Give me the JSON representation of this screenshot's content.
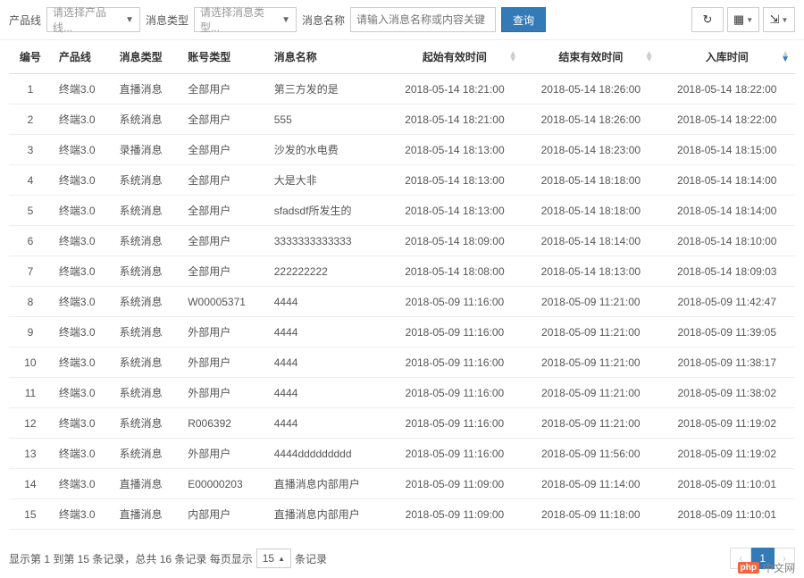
{
  "filters": {
    "productLineLabel": "产品线",
    "productLinePlaceholder": "请选择产品线...",
    "messageTypeLabel": "消息类型",
    "messageTypePlaceholder": "请选择消息类型...",
    "messageNameLabel": "消息名称",
    "messageNamePlaceholder": "请输入消息名称或内容关键",
    "queryBtn": "查询"
  },
  "icons": {
    "refresh": "↻",
    "columns": "▦",
    "export": "⇲"
  },
  "table": {
    "headers": {
      "index": "编号",
      "productLine": "产品线",
      "messageType": "消息类型",
      "accountType": "账号类型",
      "messageName": "消息名称",
      "startTime": "起始有效时间",
      "endTime": "结束有效时间",
      "storeTime": "入库时间"
    },
    "rows": [
      {
        "i": "1",
        "pl": "终端3.0",
        "mt": "直播消息",
        "at": "全部用户",
        "mn": "第三方发的是",
        "st": "2018-05-14 18:21:00",
        "et": "2018-05-14 18:26:00",
        "it": "2018-05-14 18:22:00"
      },
      {
        "i": "2",
        "pl": "终端3.0",
        "mt": "系统消息",
        "at": "全部用户",
        "mn": "555",
        "st": "2018-05-14 18:21:00",
        "et": "2018-05-14 18:26:00",
        "it": "2018-05-14 18:22:00"
      },
      {
        "i": "3",
        "pl": "终端3.0",
        "mt": "录播消息",
        "at": "全部用户",
        "mn": "沙发的水电费",
        "st": "2018-05-14 18:13:00",
        "et": "2018-05-14 18:23:00",
        "it": "2018-05-14 18:15:00"
      },
      {
        "i": "4",
        "pl": "终端3.0",
        "mt": "系统消息",
        "at": "全部用户",
        "mn": "大是大非",
        "st": "2018-05-14 18:13:00",
        "et": "2018-05-14 18:18:00",
        "it": "2018-05-14 18:14:00"
      },
      {
        "i": "5",
        "pl": "终端3.0",
        "mt": "系统消息",
        "at": "全部用户",
        "mn": "sfadsdf所发生的",
        "st": "2018-05-14 18:13:00",
        "et": "2018-05-14 18:18:00",
        "it": "2018-05-14 18:14:00"
      },
      {
        "i": "6",
        "pl": "终端3.0",
        "mt": "系统消息",
        "at": "全部用户",
        "mn": "3333333333333",
        "st": "2018-05-14 18:09:00",
        "et": "2018-05-14 18:14:00",
        "it": "2018-05-14 18:10:00"
      },
      {
        "i": "7",
        "pl": "终端3.0",
        "mt": "系统消息",
        "at": "全部用户",
        "mn": "222222222",
        "st": "2018-05-14 18:08:00",
        "et": "2018-05-14 18:13:00",
        "it": "2018-05-14 18:09:03"
      },
      {
        "i": "8",
        "pl": "终端3.0",
        "mt": "系统消息",
        "at": "W00005371",
        "mn": "4444",
        "st": "2018-05-09 11:16:00",
        "et": "2018-05-09 11:21:00",
        "it": "2018-05-09 11:42:47"
      },
      {
        "i": "9",
        "pl": "终端3.0",
        "mt": "系统消息",
        "at": "外部用户",
        "mn": "4444",
        "st": "2018-05-09 11:16:00",
        "et": "2018-05-09 11:21:00",
        "it": "2018-05-09 11:39:05"
      },
      {
        "i": "10",
        "pl": "终端3.0",
        "mt": "系统消息",
        "at": "外部用户",
        "mn": "4444",
        "st": "2018-05-09 11:16:00",
        "et": "2018-05-09 11:21:00",
        "it": "2018-05-09 11:38:17"
      },
      {
        "i": "11",
        "pl": "终端3.0",
        "mt": "系统消息",
        "at": "外部用户",
        "mn": "4444",
        "st": "2018-05-09 11:16:00",
        "et": "2018-05-09 11:21:00",
        "it": "2018-05-09 11:38:02"
      },
      {
        "i": "12",
        "pl": "终端3.0",
        "mt": "系统消息",
        "at": "R006392",
        "mn": "4444",
        "st": "2018-05-09 11:16:00",
        "et": "2018-05-09 11:21:00",
        "it": "2018-05-09 11:19:02"
      },
      {
        "i": "13",
        "pl": "终端3.0",
        "mt": "系统消息",
        "at": "外部用户",
        "mn": "4444ddddddddd",
        "st": "2018-05-09 11:16:00",
        "et": "2018-05-09 11:56:00",
        "it": "2018-05-09 11:19:02"
      },
      {
        "i": "14",
        "pl": "终端3.0",
        "mt": "直播消息",
        "at": "E00000203",
        "mn": "直播消息内部用户",
        "st": "2018-05-09 11:09:00",
        "et": "2018-05-09 11:14:00",
        "it": "2018-05-09 11:10:01"
      },
      {
        "i": "15",
        "pl": "终端3.0",
        "mt": "直播消息",
        "at": "内部用户",
        "mn": "直播消息内部用户",
        "st": "2018-05-09 11:09:00",
        "et": "2018-05-09 11:18:00",
        "it": "2018-05-09 11:10:01"
      }
    ]
  },
  "footer": {
    "summaryPrefix": "显示第 1 到第 15 条记录，总共 16 条记录 每页显示",
    "pageSize": "15",
    "summarySuffix": "条记录",
    "pagePrev": "‹",
    "page1": "1",
    "pageNext": "›"
  },
  "brand": {
    "logo": "php",
    "text": "中文网"
  }
}
